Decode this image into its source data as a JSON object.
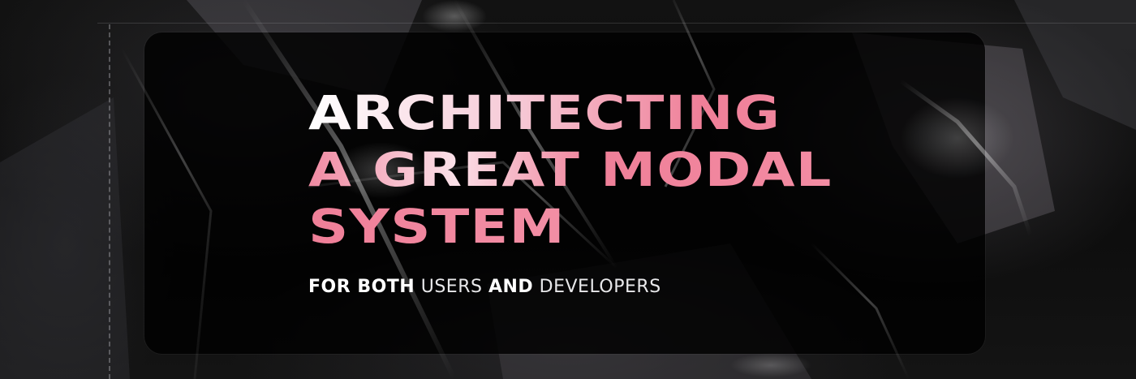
{
  "title": {
    "line1": "ARCHITECTING",
    "line2": "A GREAT MODAL",
    "line3": "SYSTEM"
  },
  "subtitle": {
    "part1": "FOR BOTH",
    "part2": "USERS",
    "part3": "AND",
    "part4": "DEVELOPERS"
  },
  "colors": {
    "accent": "#ef7f98",
    "background": "#0a0a0a",
    "panel": "#000000",
    "text": "#ffffff"
  },
  "texture": "crumpled-plastic-wrap"
}
